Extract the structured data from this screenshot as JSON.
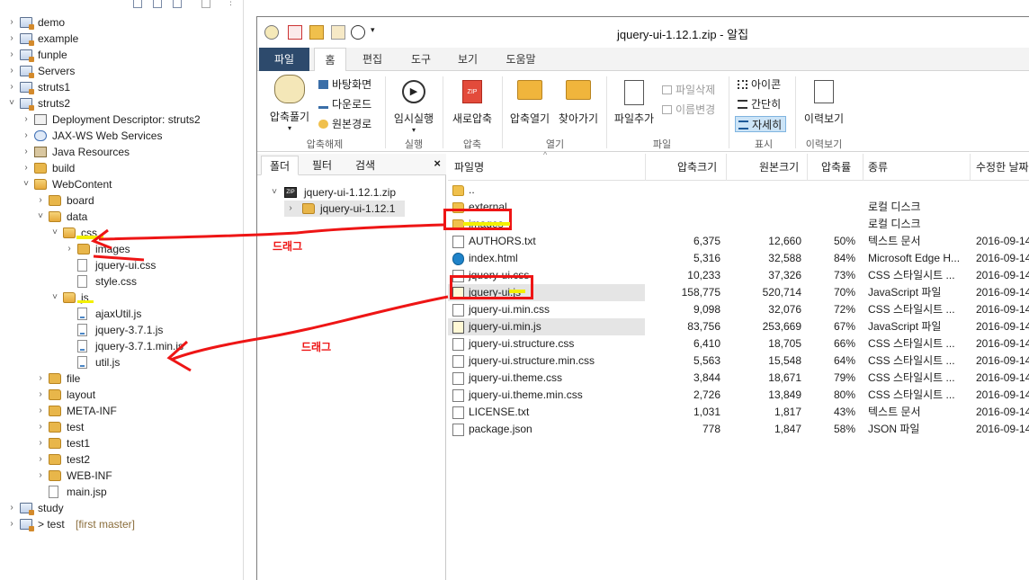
{
  "explorer": {
    "rows": [
      {
        "label": "demo",
        "level": 0,
        "twisty": "›",
        "icon": "project"
      },
      {
        "label": "example",
        "level": 0,
        "twisty": "›",
        "icon": "project"
      },
      {
        "label": "funple",
        "level": 0,
        "twisty": "›",
        "icon": "project"
      },
      {
        "label": "Servers",
        "level": 0,
        "twisty": "›",
        "icon": "project"
      },
      {
        "label": "struts1",
        "level": 0,
        "twisty": "›",
        "icon": "project"
      },
      {
        "label": "struts2",
        "level": 0,
        "twisty": "˅",
        "icon": "project"
      },
      {
        "label": "Deployment Descriptor: struts2",
        "level": 1,
        "twisty": "›",
        "icon": "desc"
      },
      {
        "label": "JAX-WS Web Services",
        "level": 1,
        "twisty": "›",
        "icon": "ws"
      },
      {
        "label": "Java Resources",
        "level": 1,
        "twisty": "›",
        "icon": "lib"
      },
      {
        "label": "build",
        "level": 1,
        "twisty": "›",
        "icon": "folder"
      },
      {
        "label": "WebContent",
        "level": 1,
        "twisty": "˅",
        "icon": "folder-open"
      },
      {
        "label": "board",
        "level": 2,
        "twisty": "›",
        "icon": "folder"
      },
      {
        "label": "data",
        "level": 2,
        "twisty": "˅",
        "icon": "folder-open"
      },
      {
        "label": "css",
        "level": 3,
        "twisty": "˅",
        "icon": "folder-open"
      },
      {
        "label": "images",
        "level": 4,
        "twisty": "›",
        "icon": "folder"
      },
      {
        "label": "jquery-ui.css",
        "level": 4,
        "twisty": "",
        "icon": "file"
      },
      {
        "label": "style.css",
        "level": 4,
        "twisty": "",
        "icon": "file"
      },
      {
        "label": "js",
        "level": 3,
        "twisty": "˅",
        "icon": "folder-open"
      },
      {
        "label": "ajaxUtil.js",
        "level": 4,
        "twisty": "",
        "icon": "jsfile"
      },
      {
        "label": "jquery-3.7.1.js",
        "level": 4,
        "twisty": "",
        "icon": "jsfile"
      },
      {
        "label": "jquery-3.7.1.min.js",
        "level": 4,
        "twisty": "",
        "icon": "jsfile"
      },
      {
        "label": "util.js",
        "level": 4,
        "twisty": "",
        "icon": "jsfile"
      },
      {
        "label": "file",
        "level": 2,
        "twisty": "›",
        "icon": "folder"
      },
      {
        "label": "layout",
        "level": 2,
        "twisty": "›",
        "icon": "folder"
      },
      {
        "label": "META-INF",
        "level": 2,
        "twisty": "›",
        "icon": "folder"
      },
      {
        "label": "test",
        "level": 2,
        "twisty": "›",
        "icon": "folder"
      },
      {
        "label": "test1",
        "level": 2,
        "twisty": "›",
        "icon": "folder"
      },
      {
        "label": "test2",
        "level": 2,
        "twisty": "›",
        "icon": "folder"
      },
      {
        "label": "WEB-INF",
        "level": 2,
        "twisty": "›",
        "icon": "folder"
      },
      {
        "label": "main.jsp",
        "level": 2,
        "twisty": "",
        "icon": "file"
      },
      {
        "label": "study",
        "level": 0,
        "twisty": "›",
        "icon": "project"
      },
      {
        "label": "> test",
        "level": 0,
        "twisty": "›",
        "icon": "project",
        "suffix": "[first master]"
      }
    ]
  },
  "zip": {
    "title": "jquery-ui-1.12.1.zip - 알집",
    "menu_tabs": [
      "파일",
      "홈",
      "편집",
      "도구",
      "보기",
      "도움말"
    ],
    "ribbon": {
      "extract": "압축풀기",
      "desktop": "바탕화면",
      "download": "다운로드",
      "original_path": "원본경로",
      "group_extract": "압축해제",
      "temp_run": "임시실행",
      "group_run": "실행",
      "new_zip": "새로압축",
      "group_zip": "압축",
      "open_zip": "압축열기",
      "find": "찾아가기",
      "group_open": "열기",
      "add_file": "파일추가",
      "delete_file": "파일삭제",
      "rename": "이름변경",
      "group_file": "파일",
      "view_icon": "아이콘",
      "view_simple": "간단히",
      "view_detail": "자세히",
      "group_view": "표시",
      "history": "이력보기",
      "group_history": "이력보기"
    },
    "folder_pane": {
      "tabs": [
        "폴더",
        "필터",
        "검색"
      ],
      "close": "×",
      "root": "jquery-ui-1.12.1.zip",
      "child": "jquery-ui-1.12.1"
    },
    "columns": [
      "파일명",
      "압축크기",
      "원본크기",
      "압축률",
      "종류",
      "수정한 날짜"
    ],
    "files": [
      {
        "name": "..",
        "comp": "",
        "orig": "",
        "ratio": "",
        "type": "",
        "date": "",
        "icon": "folder"
      },
      {
        "name": "external",
        "comp": "",
        "orig": "",
        "ratio": "",
        "type": "로컬 디스크",
        "date": "",
        "icon": "folder"
      },
      {
        "name": "images",
        "comp": "",
        "orig": "",
        "ratio": "",
        "type": "로컬 디스크",
        "date": "",
        "icon": "folder"
      },
      {
        "name": "AUTHORS.txt",
        "comp": "6,375",
        "orig": "12,660",
        "ratio": "50%",
        "type": "텍스트 문서",
        "date": "2016-09-14",
        "icon": "doc"
      },
      {
        "name": "index.html",
        "comp": "5,316",
        "orig": "32,588",
        "ratio": "84%",
        "type": "Microsoft Edge H...",
        "date": "2016-09-14",
        "icon": "edge"
      },
      {
        "name": "jquery-ui.css",
        "comp": "10,233",
        "orig": "37,326",
        "ratio": "73%",
        "type": "CSS 스타일시트 ...",
        "date": "2016-09-14",
        "icon": "doc"
      },
      {
        "name": "jquery-ui.js",
        "comp": "158,775",
        "orig": "520,714",
        "ratio": "70%",
        "type": "JavaScript 파일",
        "date": "2016-09-14",
        "icon": "js",
        "selected": true
      },
      {
        "name": "jquery-ui.min.css",
        "comp": "9,098",
        "orig": "32,076",
        "ratio": "72%",
        "type": "CSS 스타일시트 ...",
        "date": "2016-09-14",
        "icon": "doc"
      },
      {
        "name": "jquery-ui.min.js",
        "comp": "83,756",
        "orig": "253,669",
        "ratio": "67%",
        "type": "JavaScript 파일",
        "date": "2016-09-14",
        "icon": "js",
        "selected": true
      },
      {
        "name": "jquery-ui.structure.css",
        "comp": "6,410",
        "orig": "18,705",
        "ratio": "66%",
        "type": "CSS 스타일시트 ...",
        "date": "2016-09-14",
        "icon": "doc"
      },
      {
        "name": "jquery-ui.structure.min.css",
        "comp": "5,563",
        "orig": "15,548",
        "ratio": "64%",
        "type": "CSS 스타일시트 ...",
        "date": "2016-09-14",
        "icon": "doc"
      },
      {
        "name": "jquery-ui.theme.css",
        "comp": "3,844",
        "orig": "18,671",
        "ratio": "79%",
        "type": "CSS 스타일시트 ...",
        "date": "2016-09-14",
        "icon": "doc"
      },
      {
        "name": "jquery-ui.theme.min.css",
        "comp": "2,726",
        "orig": "13,849",
        "ratio": "80%",
        "type": "CSS 스타일시트 ...",
        "date": "2016-09-14",
        "icon": "doc"
      },
      {
        "name": "LICENSE.txt",
        "comp": "1,031",
        "orig": "1,817",
        "ratio": "43%",
        "type": "텍스트 문서",
        "date": "2016-09-14",
        "icon": "doc"
      },
      {
        "name": "package.json",
        "comp": "778",
        "orig": "1,847",
        "ratio": "58%",
        "type": "JSON 파일",
        "date": "2016-09-14",
        "icon": "doc"
      }
    ]
  },
  "annotations": {
    "drag1": "드래그",
    "drag2": "드래그"
  },
  "colors": {
    "accent_dark": "#2d4a6c",
    "annotation_red": "#ee1515",
    "highlight_yellow": "#f3f000",
    "selection_gray": "#e5e5e5"
  }
}
